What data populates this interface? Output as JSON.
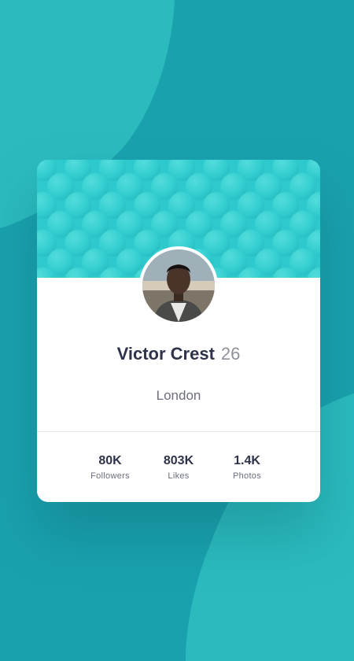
{
  "profile": {
    "name": "Victor Crest",
    "age": "26",
    "location": "London"
  },
  "stats": [
    {
      "value": "80K",
      "label": "Followers"
    },
    {
      "value": "803K",
      "label": "Likes"
    },
    {
      "value": "1.4K",
      "label": "Photos"
    }
  ],
  "colors": {
    "background": "#19a2ae",
    "background_shapes": "#2bbbbf",
    "card_header": "#2ec9cc",
    "text_primary": "#2e3349",
    "text_secondary": "#6b6e7c"
  },
  "icons": {
    "avatar": "profile-photo",
    "header_pattern": "bubble-pattern"
  }
}
